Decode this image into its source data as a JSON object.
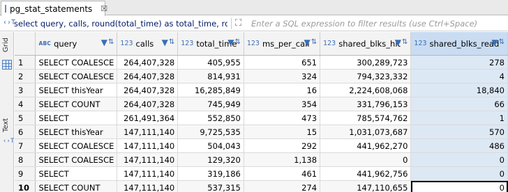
{
  "tab": {
    "label": "pg_stat_statements",
    "close": "☒"
  },
  "filter": {
    "sql_prefix_icon": "‹›T",
    "sql_text": "select query, calls, round(total_time) as total_time, round(",
    "expand_icon": "⛶",
    "placeholder": "Enter a SQL expression to filter results (use Ctrl+Space)"
  },
  "sidebar": {
    "grid_label": "Grid",
    "text_label": "Text",
    "text_icon": "‹›T"
  },
  "columns": [
    {
      "name": "query",
      "type": "ABC"
    },
    {
      "name": "calls",
      "type": "123"
    },
    {
      "name": "total_time",
      "type": "123"
    },
    {
      "name": "ms_per_call",
      "type": "123"
    },
    {
      "name": "shared_blks_hit",
      "type": "123"
    },
    {
      "name": "shared_blks_read",
      "type": "123"
    }
  ],
  "header_icons": {
    "filter": "▼",
    "sort": "⇅"
  },
  "rows": [
    {
      "n": "1",
      "cells": [
        "SELECT COALESCE",
        "264,407,328",
        "405,955",
        "651",
        "300,289,723",
        "278"
      ]
    },
    {
      "n": "2",
      "cells": [
        "SELECT COALESCE",
        "264,407,328",
        "814,931",
        "324",
        "794,323,332",
        "4"
      ]
    },
    {
      "n": "3",
      "cells": [
        "SELECT thisYear",
        "264,407,328",
        "16,285,849",
        "16",
        "2,224,608,068",
        "18,840"
      ]
    },
    {
      "n": "4",
      "cells": [
        "SELECT COUNT",
        "264,407,328",
        "745,949",
        "354",
        "331,796,153",
        "66"
      ]
    },
    {
      "n": "5",
      "cells": [
        "SELECT",
        "261,491,364",
        "552,850",
        "473",
        "785,574,762",
        "1"
      ]
    },
    {
      "n": "6",
      "cells": [
        "SELECT thisYear",
        "147,111,140",
        "9,725,535",
        "15",
        "1,031,073,687",
        "570"
      ]
    },
    {
      "n": "7",
      "cells": [
        "SELECT COALESCE",
        "147,111,140",
        "504,043",
        "292",
        "441,962,270",
        "486"
      ]
    },
    {
      "n": "8",
      "cells": [
        "SELECT COALESCE",
        "147,111,140",
        "129,320",
        "1,138",
        "0",
        "0"
      ]
    },
    {
      "n": "9",
      "cells": [
        "SELECT",
        "147,111,140",
        "319,186",
        "461",
        "441,962,756",
        "0"
      ]
    },
    {
      "n": "10",
      "cells": [
        "SELECT COUNT",
        "147,111,140",
        "537,315",
        "274",
        "147,110,655",
        "0"
      ]
    }
  ],
  "colors": {
    "accent": "#3a6eb5",
    "selected_column": "#c9dcf2",
    "selected_cells": "#dde8f5"
  }
}
